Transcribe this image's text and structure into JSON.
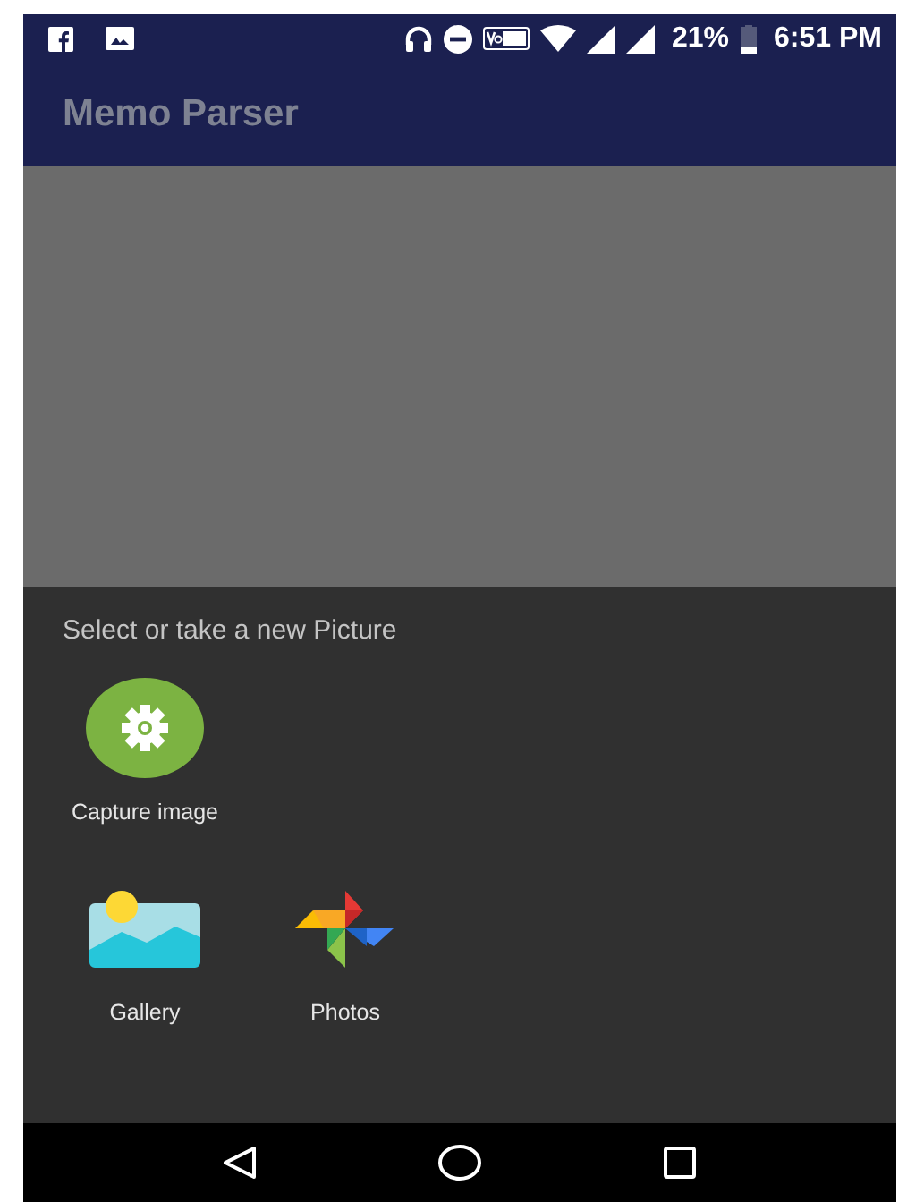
{
  "status_bar": {
    "battery": "21%",
    "time": "6:51 PM"
  },
  "app_bar": {
    "title": "Memo Parser"
  },
  "sheet": {
    "title": "Select or take a new Picture",
    "rows": [
      [
        {
          "kind": "capture",
          "label": "Capture image"
        }
      ],
      [
        {
          "kind": "gallery",
          "label": "Gallery"
        },
        {
          "kind": "photos",
          "label": "Photos"
        }
      ]
    ]
  }
}
